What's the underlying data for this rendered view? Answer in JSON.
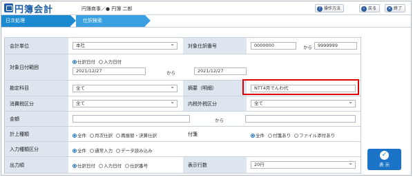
{
  "app": {
    "title": "円簿会計",
    "company": "円簿商事／● 円簿 二郎"
  },
  "toolbar": {
    "help": "操作方法",
    "back": "戻る",
    "close": "終了"
  },
  "breadcrumb": {
    "item1": "日次処理",
    "item2": "仕訳検索"
  },
  "form": {
    "unit_label": "会計単位",
    "unit_value": "本社",
    "journal_no_label": "対象仕訳番号",
    "journal_no_from": "0000000",
    "journal_no_to": "9999999",
    "from_to": "から",
    "date_range_label": "対象日付範囲",
    "date_opt1": "仕訳日付",
    "date_opt2": "入力日付",
    "date_from": "2021/12/27",
    "date_to": "2021/12/27",
    "account_label": "勘定科目",
    "account_value": "全て",
    "summary_label": "摘要（明細）",
    "summary_value": "NTT4月でんわ代",
    "tax_class_label": "消費税区分",
    "tax_class_value": "全て",
    "tax_inout_label": "内税外税区分",
    "tax_inout_value": "全て",
    "amount_label": "金額",
    "report_type_label": "計上種類",
    "report_opts": [
      "全件",
      "月次仕訳",
      "再振替・決算仕訳"
    ],
    "attachment_label": "付箋",
    "attachment_opts": [
      "全件",
      "付箋あり",
      "ファイル添付あり"
    ],
    "input_type_label": "入力種類区分",
    "input_opts": [
      "全件",
      "通常入力",
      "データ読み込み"
    ],
    "output_order_label": "出力順",
    "output_opts": [
      "仕訳日付",
      "入力日付",
      "仕訳番号"
    ],
    "rows_label": "表示行数",
    "rows_value": "20行"
  },
  "actions": {
    "show": "表 示"
  }
}
